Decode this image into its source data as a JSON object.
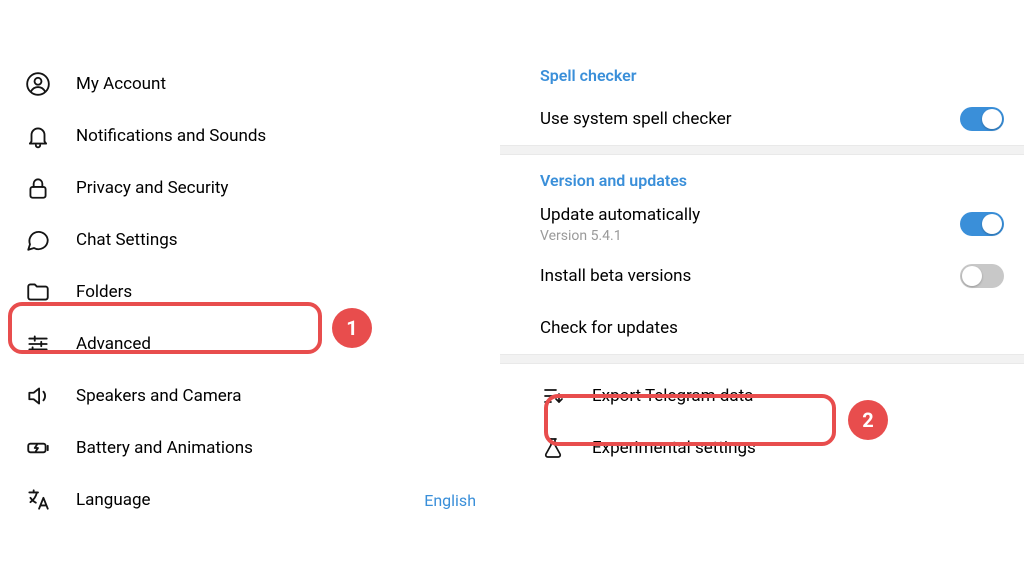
{
  "sidebar": {
    "items": [
      {
        "label": "My Account"
      },
      {
        "label": "Notifications and Sounds"
      },
      {
        "label": "Privacy and Security"
      },
      {
        "label": "Chat Settings"
      },
      {
        "label": "Folders"
      },
      {
        "label": "Advanced"
      },
      {
        "label": "Speakers and Camera"
      },
      {
        "label": "Battery and Animations"
      },
      {
        "label": "Language"
      }
    ],
    "language_value": "English"
  },
  "right": {
    "spell": {
      "header": "Spell checker",
      "use_system": "Use system spell checker"
    },
    "version": {
      "header": "Version and updates",
      "update_auto": "Update automatically",
      "version_label": "Version 5.4.1",
      "install_beta": "Install beta versions",
      "check_updates": "Check for updates"
    },
    "tools": {
      "export": "Export Telegram data",
      "experimental": "Experimental settings"
    }
  },
  "annotations": {
    "badge1": "1",
    "badge2": "2"
  }
}
